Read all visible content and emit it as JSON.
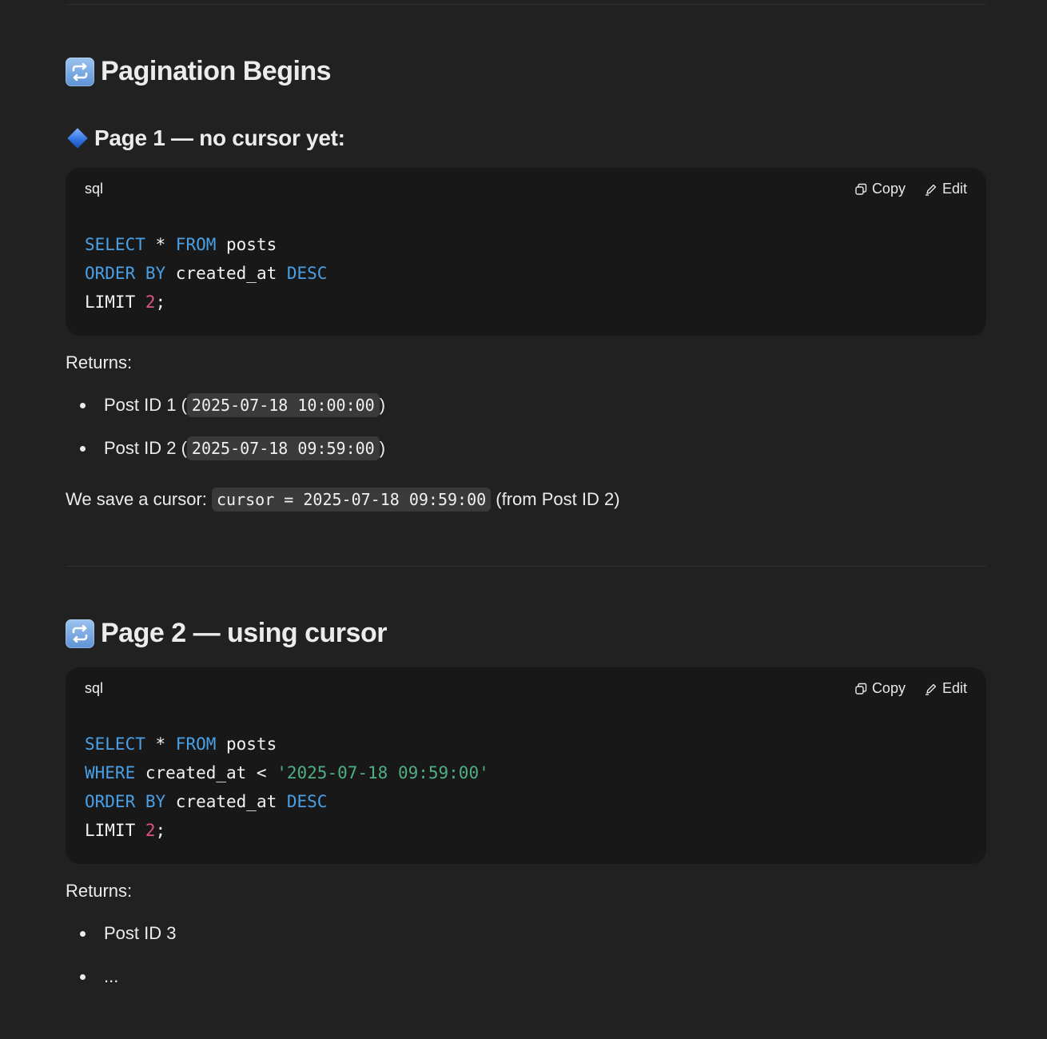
{
  "section1": {
    "heading": "Pagination Begins",
    "subheading": "Page 1 — no cursor yet:",
    "code": {
      "lang": "sql",
      "copy_label": "Copy",
      "edit_label": "Edit"
    },
    "returns_label": "Returns:",
    "items": [
      {
        "prefix": "Post ID 1 (",
        "code": "2025-07-18 10:00:00",
        "suffix": ")"
      },
      {
        "prefix": "Post ID 2 (",
        "code": "2025-07-18 09:59:00",
        "suffix": ")"
      }
    ],
    "cursor_prefix": "We save a cursor:",
    "cursor_code": "cursor = 2025-07-18 09:59:00",
    "cursor_suffix": "(from Post ID 2)"
  },
  "section2": {
    "heading": "Page 2 — using cursor",
    "code": {
      "lang": "sql",
      "copy_label": "Copy",
      "edit_label": "Edit"
    },
    "returns_label": "Returns:",
    "items": [
      "Post ID 3",
      "..."
    ]
  },
  "sql": {
    "select": "SELECT",
    "star": " * ",
    "from": "FROM",
    "table": " posts",
    "where": "WHERE",
    "where_rest": " created_at < ",
    "where_value": "'2025-07-18 09:59:00'",
    "order": "ORDER BY",
    "order_col": " created_at ",
    "desc": "DESC",
    "limit": "LIMIT ",
    "limit_value": "2",
    "semi": ";"
  },
  "icons": [
    "repeat-emoji-icon",
    "blue-diamond-icon",
    "copy-icon",
    "edit-icon"
  ],
  "colors": {
    "background": "#212121",
    "code_background": "#181818",
    "keyword": "#4aa0e6",
    "number": "#e05287",
    "string": "#4fae84",
    "inline_code_bg": "#3a3a3a"
  }
}
